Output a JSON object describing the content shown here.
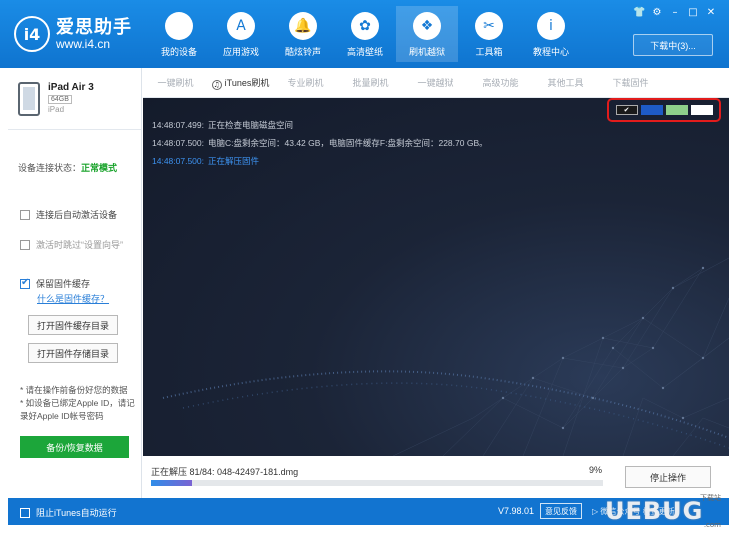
{
  "app": {
    "logo_badge": "i4",
    "name": "爱思助手",
    "url": "www.i4.cn"
  },
  "window_controls": [
    "👕",
    "⚙",
    "–",
    "□",
    "✕"
  ],
  "download_button": "下载中(3)...",
  "nav": [
    {
      "label": "我的设备",
      "icon": "apple-icon",
      "glyph": ""
    },
    {
      "label": "应用游戏",
      "icon": "app-store-icon",
      "glyph": "A"
    },
    {
      "label": "酷炫铃声",
      "icon": "bell-icon",
      "glyph": "🔔"
    },
    {
      "label": "高清壁纸",
      "icon": "flower-icon",
      "glyph": "✿"
    },
    {
      "label": "刷机越狱",
      "icon": "dropbox-icon",
      "glyph": "❖"
    },
    {
      "label": "工具箱",
      "icon": "tools-icon",
      "glyph": "✂"
    },
    {
      "label": "教程中心",
      "icon": "info-icon",
      "glyph": "i"
    }
  ],
  "device": {
    "name": "iPad Air 3",
    "capacity": "64GB",
    "type": "iPad"
  },
  "connection": {
    "label": "设备连接状态：",
    "status": "正常模式"
  },
  "options": {
    "auto_activate": "连接后自动激活设备",
    "skip_guide": "激活时跳过“设置向导”",
    "keep_firmware": "保留固件缓存",
    "what_is_cache": "什么是固件缓存？",
    "open_cache_dir": "打开固件缓存目录",
    "open_storage_dir": "打开固件存储目录"
  },
  "notes": [
    "* 请在操作前备份好您的数据",
    "* 如设备已绑定Apple ID，请记录好Apple ID帐号密码"
  ],
  "backup_button": "备份/恢复数据",
  "tabs": [
    "一键刷机",
    "iTunes刷机",
    "专业刷机",
    "批量刷机",
    "一键越狱",
    "高级功能",
    "其他工具",
    "下载固件"
  ],
  "active_tab_index": 1,
  "log": [
    {
      "time": "14:48:07.499:",
      "text": "正在检查电脑磁盘空间"
    },
    {
      "time": "14:48:07.500:",
      "text": "电脑C:盘剩余空间：43.42 GB，电脑固件缓存F:盘剩余空间：228.70 GB。"
    },
    {
      "time": "14:48:07.500:",
      "text": "正在解压固件"
    }
  ],
  "theme_swatches": [
    {
      "name": "dark-theme",
      "color": "#1a1a1a",
      "selected": true
    },
    {
      "name": "blue-theme",
      "color": "#1e5bc6",
      "selected": false
    },
    {
      "name": "green-theme",
      "color": "#8fd08a",
      "selected": false
    },
    {
      "name": "white-theme",
      "color": "#ffffff",
      "selected": false
    }
  ],
  "progress": {
    "text": "正在解压 81/84: 048-42497-181.dmg",
    "percent_label": "9%",
    "fraction": 0.09
  },
  "stop_button": "停止操作",
  "status": {
    "block_itunes": "阻止iTunes自动运行",
    "version": "V7.98.01",
    "feedback": "意见反馈",
    "extra": "▷ 微信公众号   检查更新"
  },
  "watermark": {
    "brand": "UEBUG",
    "top": "下载站",
    "bottom": ".com"
  },
  "colors": {
    "header_blue": "#1479d4",
    "accent_green": "#1ca63a",
    "status_green": "#19a32b",
    "log_bg": "#161d2d",
    "highlight_red": "#e21c1c"
  }
}
